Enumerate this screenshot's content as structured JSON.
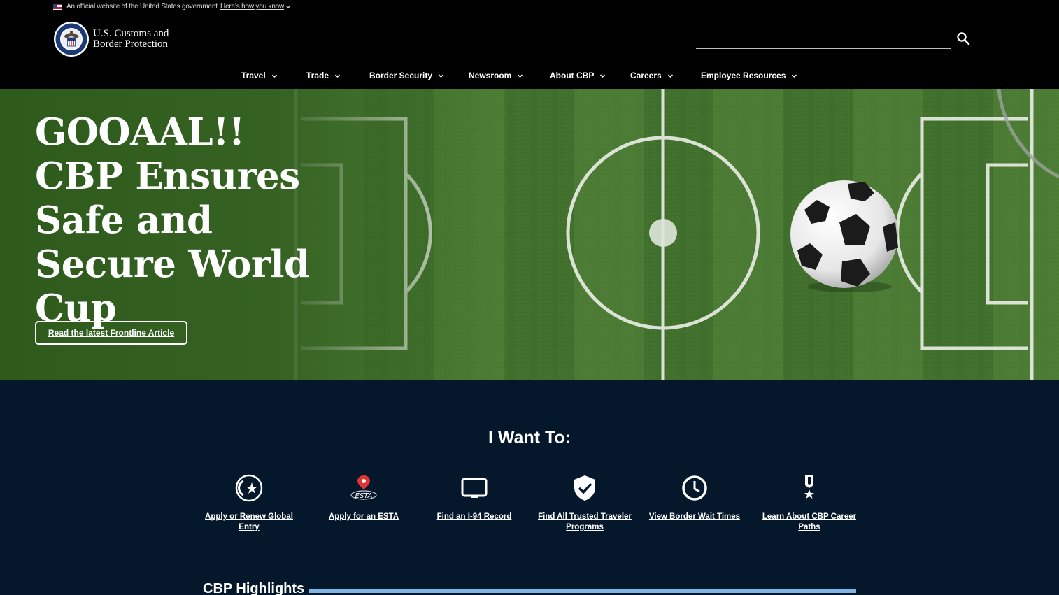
{
  "gov_banner": {
    "official_text": "An official website of the United States government",
    "how_you_know_link": "Here’s how you know",
    "flag_icon": "us-flag-icon"
  },
  "header": {
    "logo_line1": "U.S. Customs and",
    "logo_line2": "Border Protection",
    "search_placeholder": "",
    "search_icon": "search-icon"
  },
  "nav": {
    "items": [
      {
        "label": "Travel"
      },
      {
        "label": "Trade"
      },
      {
        "label": "Border Security"
      },
      {
        "label": "Newsroom"
      },
      {
        "label": "About CBP"
      },
      {
        "label": "Careers"
      },
      {
        "label": "Employee Resources"
      }
    ]
  },
  "hero": {
    "title": "GOOAAL!! CBP Ensures Safe and Secure World Cup",
    "button_label": "Read the latest Frontline Article"
  },
  "want": {
    "title": "I Want To:",
    "items": [
      {
        "label": "Apply or Renew Global Entry",
        "icon": "global-entry-icon"
      },
      {
        "label": "Apply for an ESTA",
        "icon": "esta-location-icon"
      },
      {
        "label": "Find an I-94 Record",
        "icon": "i94-record-icon"
      },
      {
        "label": "Find All Trusted Traveler Programs",
        "icon": "shield-check-icon"
      },
      {
        "label": "View Border Wait Times",
        "icon": "clock-icon"
      },
      {
        "label": "Learn About CBP Career Paths",
        "icon": "medal-icon"
      }
    ]
  },
  "highlights": {
    "title": "CBP Highlights"
  },
  "colors": {
    "background": "#000000",
    "section_navy": "#04172b",
    "accent_blue": "#7fb4e6",
    "field_green": "#2f5a22",
    "esta_red": "#e03535"
  }
}
